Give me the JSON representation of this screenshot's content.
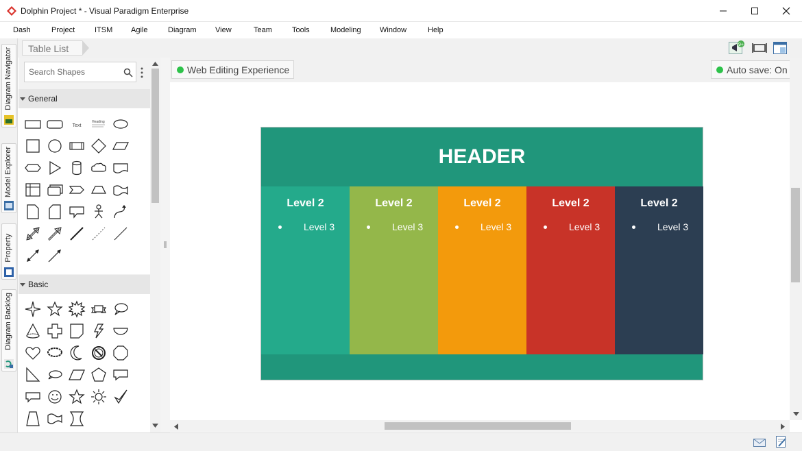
{
  "window": {
    "title": "Dolphin Project * - Visual Paradigm Enterprise"
  },
  "menu": [
    "Dash",
    "Project",
    "ITSM",
    "Agile",
    "Diagram",
    "View",
    "Team",
    "Tools",
    "Modeling",
    "Window",
    "Help"
  ],
  "toolbar": {
    "breadcrumb": "Table List",
    "notification_badge": "9+"
  },
  "side_tabs": [
    "Diagram Navigator",
    "Model Explorer",
    "Property",
    "Diagram Backlog"
  ],
  "palette": {
    "search_placeholder": "Search Shapes",
    "categories": [
      {
        "label": "General"
      },
      {
        "label": "Basic"
      }
    ],
    "mini_text": "Text",
    "mini_heading": "Heading"
  },
  "canvas": {
    "web_editing": "Web Editing Experience",
    "auto_save": "Auto save: On"
  },
  "diagram": {
    "header": "HEADER",
    "colors": {
      "header": "#20967b",
      "footer": "#20967b"
    },
    "columns": [
      {
        "level2": "Level 2",
        "level3": "Level 3",
        "color": "#24aa8b"
      },
      {
        "level2": "Level 2",
        "level3": "Level 3",
        "color": "#94b74a"
      },
      {
        "level2": "Level 2",
        "level3": "Level 3",
        "color": "#f39a0c"
      },
      {
        "level2": "Level 2",
        "level3": "Level 3",
        "color": "#c83328"
      },
      {
        "level2": "Level 2",
        "level3": "Level 3",
        "color": "#2c3e52"
      }
    ]
  }
}
